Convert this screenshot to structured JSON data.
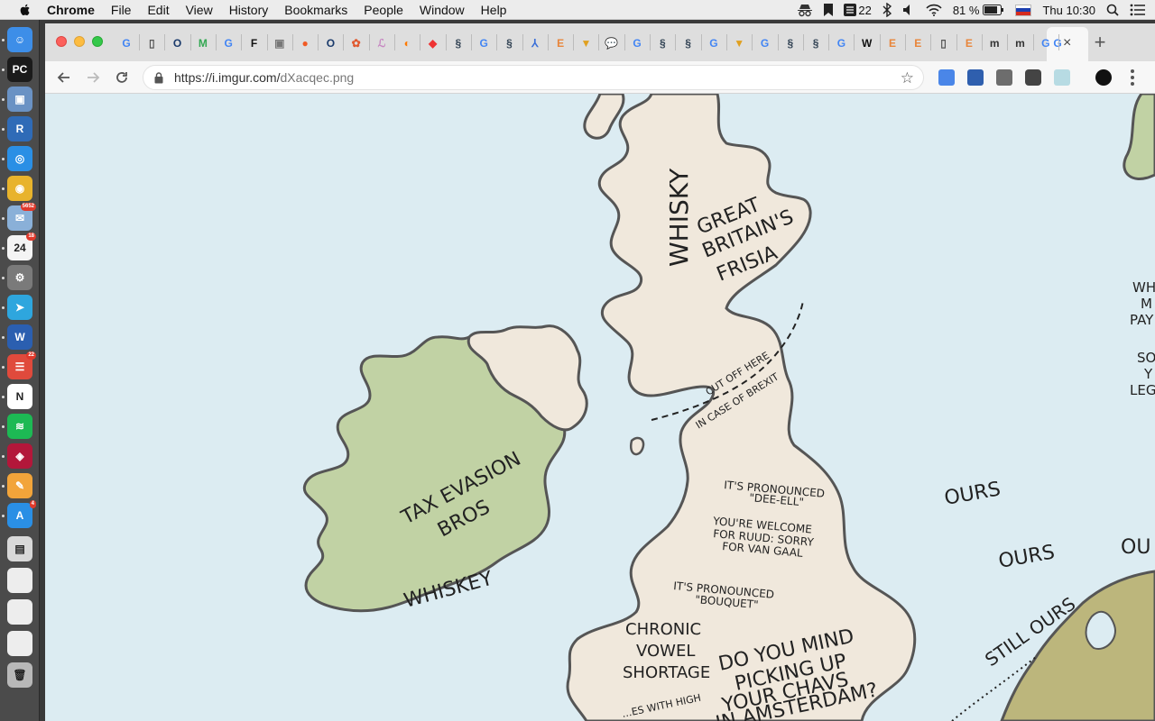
{
  "menubar": {
    "app_name": "Chrome",
    "items": [
      "File",
      "Edit",
      "View",
      "History",
      "Bookmarks",
      "People",
      "Window",
      "Help"
    ],
    "status": {
      "notifications": "22",
      "battery": "81 %",
      "clock": "Thu 10:30"
    }
  },
  "dock": {
    "apps": [
      {
        "name": "finder",
        "color": "#3d8ee8",
        "glyph": "☺"
      },
      {
        "name": "pycharm",
        "color": "#1b1b1b",
        "glyph": "PC"
      },
      {
        "name": "preview",
        "color": "#6a92c4",
        "glyph": "▣"
      },
      {
        "name": "r",
        "color": "#2f6bb7",
        "glyph": "R"
      },
      {
        "name": "safari",
        "color": "#2a8fe5",
        "glyph": "◎"
      },
      {
        "name": "chrome",
        "color": "#e8b32c",
        "glyph": "◉"
      },
      {
        "name": "mail-preview",
        "color": "#8ab0d8",
        "glyph": "✉",
        "badge": "5652"
      },
      {
        "name": "calendar",
        "color": "#f4f4f4",
        "glyph": "24",
        "badge": "18"
      },
      {
        "name": "system-preferences",
        "color": "#7a7a7a",
        "glyph": "⚙"
      },
      {
        "name": "telegram",
        "color": "#2ea6de",
        "glyph": "➤"
      },
      {
        "name": "word",
        "color": "#2b5fb0",
        "glyph": "W"
      },
      {
        "name": "todoist",
        "color": "#e04a3c",
        "glyph": "☰",
        "badge": "22"
      },
      {
        "name": "notion",
        "color": "#ffffff",
        "glyph": "N"
      },
      {
        "name": "spotify",
        "color": "#1db954",
        "glyph": "≋"
      },
      {
        "name": "mendeley",
        "color": "#b3173a",
        "glyph": "◈"
      },
      {
        "name": "pages",
        "color": "#f2a43a",
        "glyph": "✎"
      },
      {
        "name": "app-store",
        "color": "#2a8fe5",
        "glyph": "A",
        "badge": "4"
      },
      {
        "name": "document",
        "color": "#d8d8d8",
        "glyph": "▤"
      },
      {
        "name": "window-1",
        "color": "#ededed",
        "glyph": ""
      },
      {
        "name": "window-2",
        "color": "#ededed",
        "glyph": ""
      },
      {
        "name": "window-3",
        "color": "#ededed",
        "glyph": ""
      },
      {
        "name": "trash",
        "color": "#b8b8b8",
        "glyph": "🗑"
      }
    ]
  },
  "browser": {
    "url_host": "https://i.imgur.com/",
    "url_path": "dXacqec.png",
    "tab_favicons": [
      "G",
      "▯",
      "O",
      "M",
      "G",
      "F",
      "▣",
      "●",
      "O",
      "✿",
      "ℒ",
      "◐",
      "◆",
      "§",
      "G",
      "§",
      "⅄",
      "E",
      "▼",
      "💬",
      "G",
      "§",
      "§",
      "G",
      "▼",
      "G",
      "§",
      "§",
      "G",
      "W",
      "E",
      "E",
      "▯",
      "E",
      "m",
      "m",
      "G"
    ],
    "tab_close": "×",
    "new_tab": "+"
  },
  "map": {
    "labels": {
      "whisky": "WHISKY",
      "great_britains_1": "GREAT",
      "great_britains_2": "BRITAIN'S",
      "great_britains_3": "FRISIA",
      "cut_off_1": "CUT OFF HERE",
      "cut_off_2": "IN CASE OF BREXIT",
      "tax_1": "TAX EVASION",
      "tax_2": "BROS",
      "whiskey": "WHISKEY",
      "pron_dl_1": "IT'S PRONOUNCED",
      "pron_dl_2": "\"DEE-ELL\"",
      "welcome_1": "YOU'RE WELCOME",
      "welcome_2": "FOR RUUD: SORRY",
      "welcome_3": "FOR VAN GAAL",
      "pron_bouquet_1": "IT'S PRONOUNCED",
      "pron_bouquet_2": "\"BOUQUET\"",
      "chronic_1": "CHRONIC",
      "chronic_2": "VOWEL",
      "chronic_3": "SHORTAGE",
      "chavs_1": "DO YOU MIND",
      "chavs_2": "PICKING UP",
      "chavs_3": "YOUR CHAVS",
      "chavs_4": "IN AMSTERDAM?",
      "high_partial": "…ES WITH HIGH",
      "ours_1": "OURS",
      "ours_2": "OURS",
      "ours_3": "OU",
      "still_ours": "STILL OURS",
      "edge_1": "WH",
      "edge_2": "M",
      "edge_3": "PAY",
      "edge_4": "SO",
      "edge_5": "Y",
      "edge_6": "LEG"
    },
    "colors": {
      "sea": "#dcecf2",
      "britain": "#f0e8dc",
      "ireland": "#c1d2a4",
      "continent": "#bcb67c",
      "coast": "#555555"
    }
  }
}
